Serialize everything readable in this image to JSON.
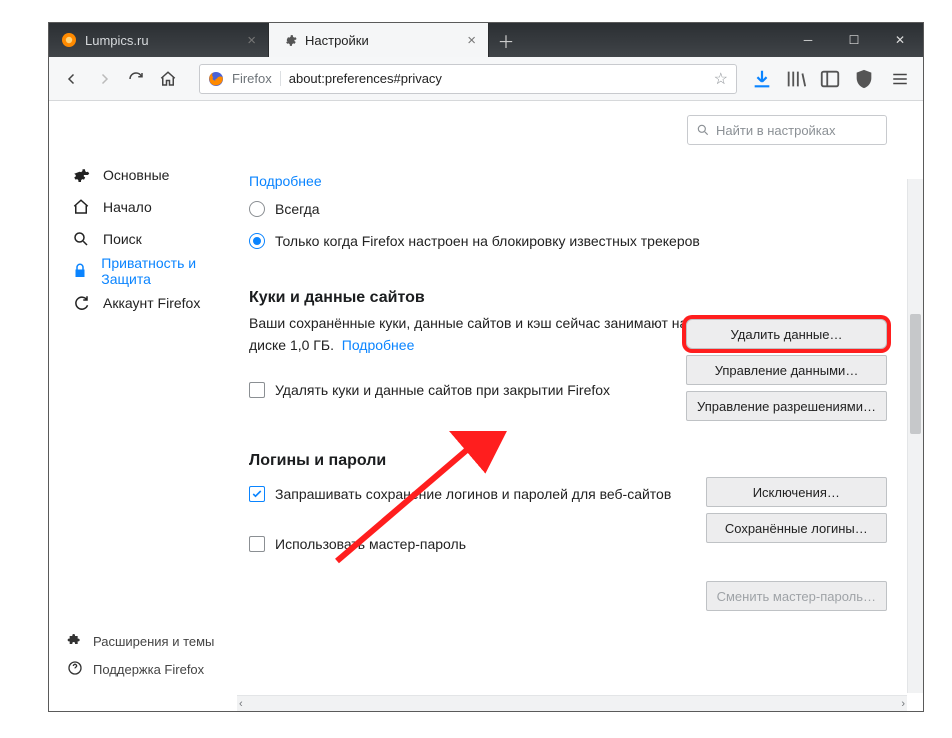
{
  "tabs": [
    {
      "label": "Lumpics.ru",
      "active": false
    },
    {
      "label": "Настройки",
      "active": true
    }
  ],
  "urlbar": {
    "brand": "Firefox",
    "address": "about:preferences#privacy"
  },
  "search": {
    "placeholder": "Найти в настройках"
  },
  "sidebar": {
    "items": [
      {
        "key": "general",
        "label": "Основные"
      },
      {
        "key": "home",
        "label": "Начало"
      },
      {
        "key": "search",
        "label": "Поиск"
      },
      {
        "key": "privacy",
        "label": "Приватность и Защита"
      },
      {
        "key": "account",
        "label": "Аккаунт Firefox"
      }
    ],
    "bottom": {
      "addons": "Расширения и темы",
      "support": "Поддержка Firefox"
    }
  },
  "tracking": {
    "more_link": "Подробнее",
    "opt_always": "Всегда",
    "opt_onlyknown": "Только когда Firefox настроен на блокировку известных трекеров"
  },
  "cookies": {
    "heading": "Куки и данные сайтов",
    "desc_a": "Ваши сохранённые куки, данные сайтов и кэш сейчас занимают на диске ",
    "size": "1,0 ГБ",
    "desc_b": ".",
    "more_link": "Подробнее",
    "delete_on_close": "Удалять куки и данные сайтов при закрытии Firefox",
    "buttons": {
      "delete": "Удалить данные…",
      "manage": "Управление данными…",
      "perms": "Управление разрешениями…"
    }
  },
  "logins": {
    "heading": "Логины и пароли",
    "ask_save": "Запрашивать сохранение логинов и паролей для веб-сайтов",
    "use_master": "Использовать мастер-пароль",
    "buttons": {
      "exceptions": "Исключения…",
      "saved": "Сохранённые логины…",
      "change_mp": "Сменить мастер-пароль…"
    }
  }
}
